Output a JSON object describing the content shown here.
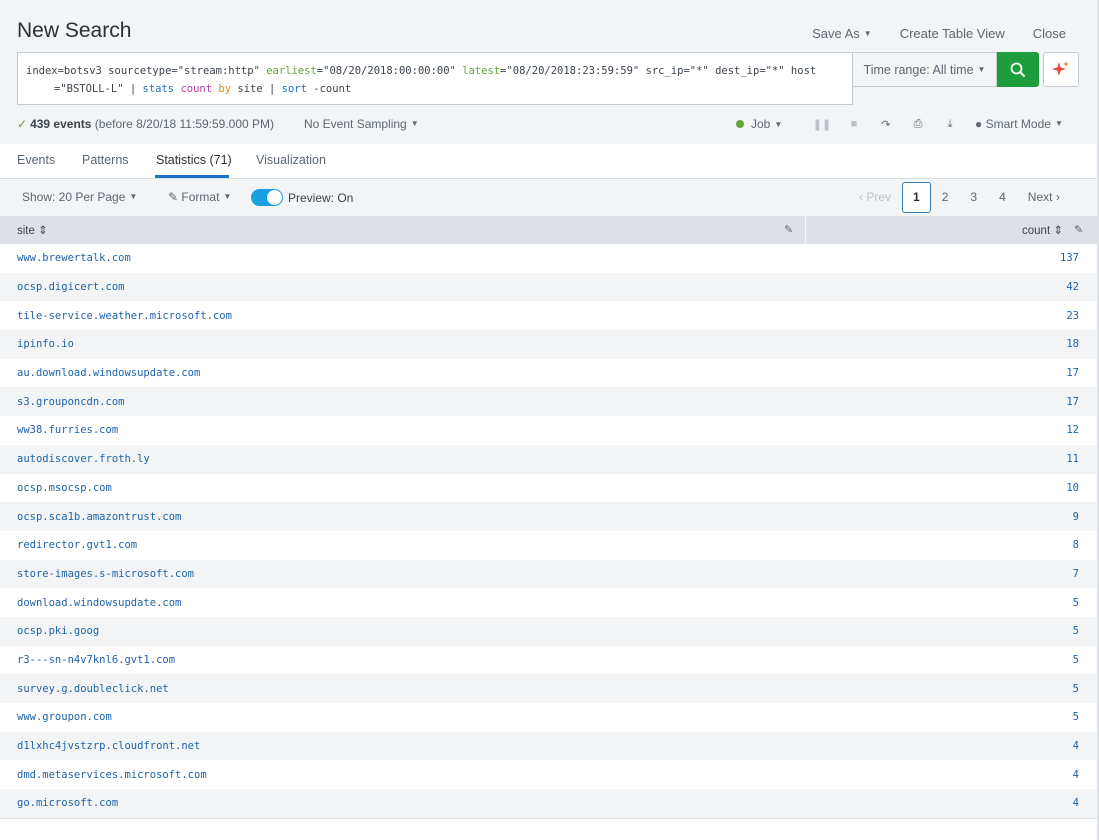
{
  "header": {
    "title": "New Search",
    "save_as": "Save As",
    "create_table_view": "Create Table View",
    "close": "Close"
  },
  "search": {
    "t1": "index=botsv3 sourcetype=\"stream:http\" ",
    "t2": "earliest",
    "t3": "=\"08/20/2018:00:00:00\" ",
    "t4": "latest",
    "t5": "=\"08/20/2018:23:59:59\" src_ip=\"*\" dest_ip=\"*\" host",
    "t6": "=\"BSTOLL-L\" | ",
    "t7": "stats",
    "t8": " ",
    "t9": "count",
    "t10": " ",
    "t11": "by",
    "t12": " site | ",
    "t13": "sort",
    "t14": " -count"
  },
  "time_range": "Time range: All time",
  "status": {
    "events": "439 events",
    "before": "(before 8/20/18 11:59:59.000 PM)",
    "sampling": "No Event Sampling",
    "job": "Job",
    "smart_mode": "Smart Mode"
  },
  "tabs": [
    {
      "label": "Events"
    },
    {
      "label": "Patterns"
    },
    {
      "label": "Statistics (71)"
    },
    {
      "label": "Visualization"
    }
  ],
  "toolbar": {
    "show": "Show: 20 Per Page",
    "format": "Format",
    "preview": "Preview: On"
  },
  "pager": {
    "prev": "Prev",
    "pages": [
      "1",
      "2",
      "3",
      "4"
    ],
    "next": "Next"
  },
  "table": {
    "col_site": "site",
    "col_count": "count",
    "rows": [
      {
        "site": "www.brewertalk.com",
        "count": "137"
      },
      {
        "site": "ocsp.digicert.com",
        "count": "42"
      },
      {
        "site": "tile-service.weather.microsoft.com",
        "count": "23"
      },
      {
        "site": "ipinfo.io",
        "count": "18"
      },
      {
        "site": "au.download.windowsupdate.com",
        "count": "17"
      },
      {
        "site": "s3.grouponcdn.com",
        "count": "17"
      },
      {
        "site": "ww38.furries.com",
        "count": "12"
      },
      {
        "site": "autodiscover.froth.ly",
        "count": "11"
      },
      {
        "site": "ocsp.msocsp.com",
        "count": "10"
      },
      {
        "site": "ocsp.sca1b.amazontrust.com",
        "count": "9"
      },
      {
        "site": "redirector.gvt1.com",
        "count": "8"
      },
      {
        "site": "store-images.s-microsoft.com",
        "count": "7"
      },
      {
        "site": "download.windowsupdate.com",
        "count": "5"
      },
      {
        "site": "ocsp.pki.goog",
        "count": "5"
      },
      {
        "site": "r3---sn-n4v7knl6.gvt1.com",
        "count": "5"
      },
      {
        "site": "survey.g.doubleclick.net",
        "count": "5"
      },
      {
        "site": "www.groupon.com",
        "count": "5"
      },
      {
        "site": "d1lxhc4jvstzrp.cloudfront.net",
        "count": "4"
      },
      {
        "site": "dmd.metaservices.microsoft.com",
        "count": "4"
      },
      {
        "site": "go.microsoft.com",
        "count": "4"
      }
    ]
  },
  "colors": {
    "accent": "#1a73c7",
    "search_button": "#1e9d3c",
    "link": "#1e63a8",
    "success": "#65a637"
  }
}
